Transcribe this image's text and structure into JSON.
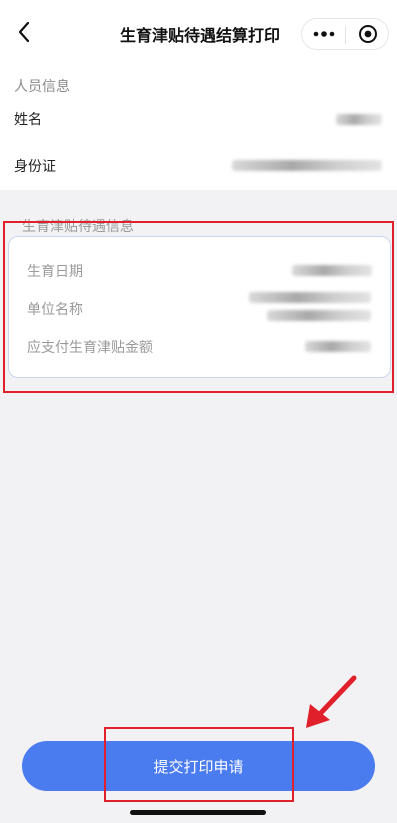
{
  "header": {
    "title": "生育津贴待遇结算打印",
    "back_icon": "chevron-left-icon",
    "more_icon": "more-dots-icon",
    "close_icon": "record-close-icon"
  },
  "personal_info": {
    "section_title": "人员信息",
    "fields": [
      {
        "label": "姓名"
      },
      {
        "label": "身份证"
      }
    ]
  },
  "subsidy_info": {
    "section_title": "生育津贴待遇信息",
    "fields": [
      {
        "label": "生育日期"
      },
      {
        "label": "单位名称"
      },
      {
        "label": "应支付生育津贴金额"
      }
    ]
  },
  "footer": {
    "submit_label": "提交打印申请"
  },
  "colors": {
    "accent": "#4a7cf0",
    "highlight": "#e0202a",
    "card_border": "#c9d6ef"
  }
}
